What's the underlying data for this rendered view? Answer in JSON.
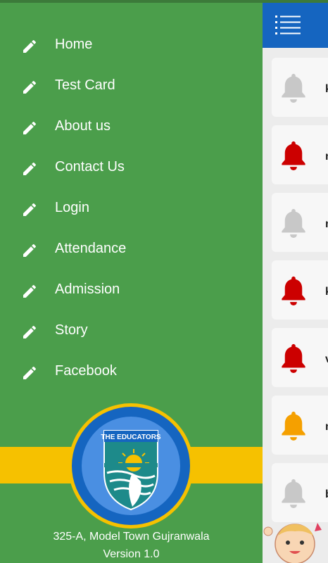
{
  "drawer": {
    "items": [
      {
        "label": "Home"
      },
      {
        "label": "Test Card"
      },
      {
        "label": "About us"
      },
      {
        "label": "Contact Us"
      },
      {
        "label": "Login"
      },
      {
        "label": "Attendance"
      },
      {
        "label": "Admission"
      },
      {
        "label": "Story"
      },
      {
        "label": "Facebook"
      }
    ],
    "logo_text": "THE EDUCATORS",
    "address": "325-A, Model Town Gujranwala",
    "version": "Version 1.0"
  },
  "notifications": [
    {
      "letter": "k",
      "bell_color": "#c8c8c8"
    },
    {
      "letter": "n",
      "bell_color": "#cc0000"
    },
    {
      "letter": "n",
      "bell_color": "#c8c8c8"
    },
    {
      "letter": "k",
      "bell_color": "#cc0000"
    },
    {
      "letter": "v",
      "bell_color": "#cc0000"
    },
    {
      "letter": "n",
      "bell_color": "#f5a000"
    },
    {
      "letter": "b",
      "bell_color": "#c8c8c8"
    }
  ],
  "colors": {
    "drawer_bg": "#4b9e4b",
    "appbar_bg": "#1565c0",
    "band": "#f6c100",
    "logo_ring": "#1565c0"
  },
  "icons": {
    "menu": "hamburger-list-icon",
    "item": "pencil-icon",
    "notification": "bell-icon"
  }
}
